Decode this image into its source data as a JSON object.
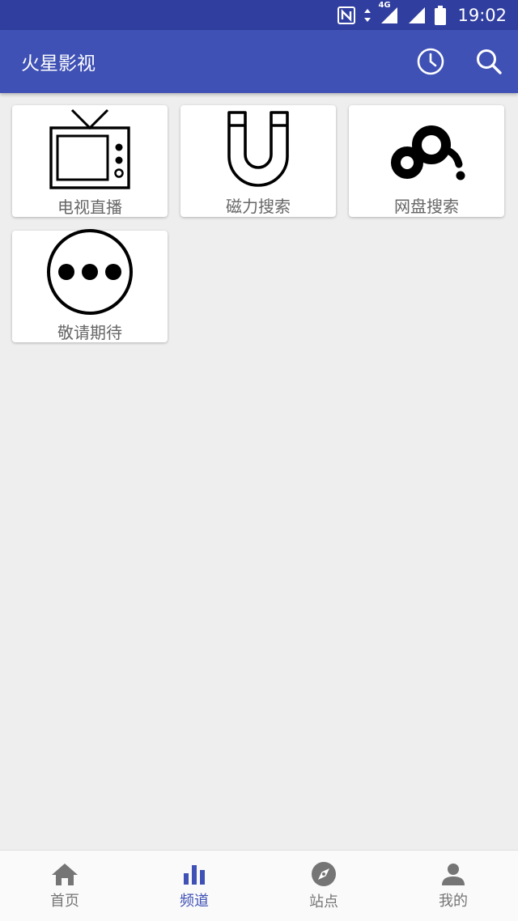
{
  "status_bar": {
    "time": "19:02",
    "network": "4G",
    "icons": [
      "nfc-icon",
      "data-arrows-icon",
      "signal-icon",
      "signal-icon",
      "battery-icon"
    ]
  },
  "app_bar": {
    "title": "火星影视",
    "actions": [
      "history-clock-icon",
      "search-icon"
    ]
  },
  "channels": [
    {
      "label": "电视直播",
      "icon": "tv-icon"
    },
    {
      "label": "磁力搜索",
      "icon": "magnet-icon"
    },
    {
      "label": "网盘搜索",
      "icon": "cloud-disk-icon"
    },
    {
      "label": "敬请期待",
      "icon": "more-dots-icon"
    }
  ],
  "bottom_nav": {
    "items": [
      {
        "label": "首页",
        "icon": "home-icon"
      },
      {
        "label": "频道",
        "icon": "bar-chart-icon"
      },
      {
        "label": "站点",
        "icon": "compass-icon"
      },
      {
        "label": "我的",
        "icon": "person-icon"
      }
    ],
    "active_index": 1
  },
  "colors": {
    "status_bar": "#303f9f",
    "app_bar": "#3f51b5",
    "accent": "#3f51b5",
    "inactive": "#757575",
    "background": "#eeeeee"
  }
}
